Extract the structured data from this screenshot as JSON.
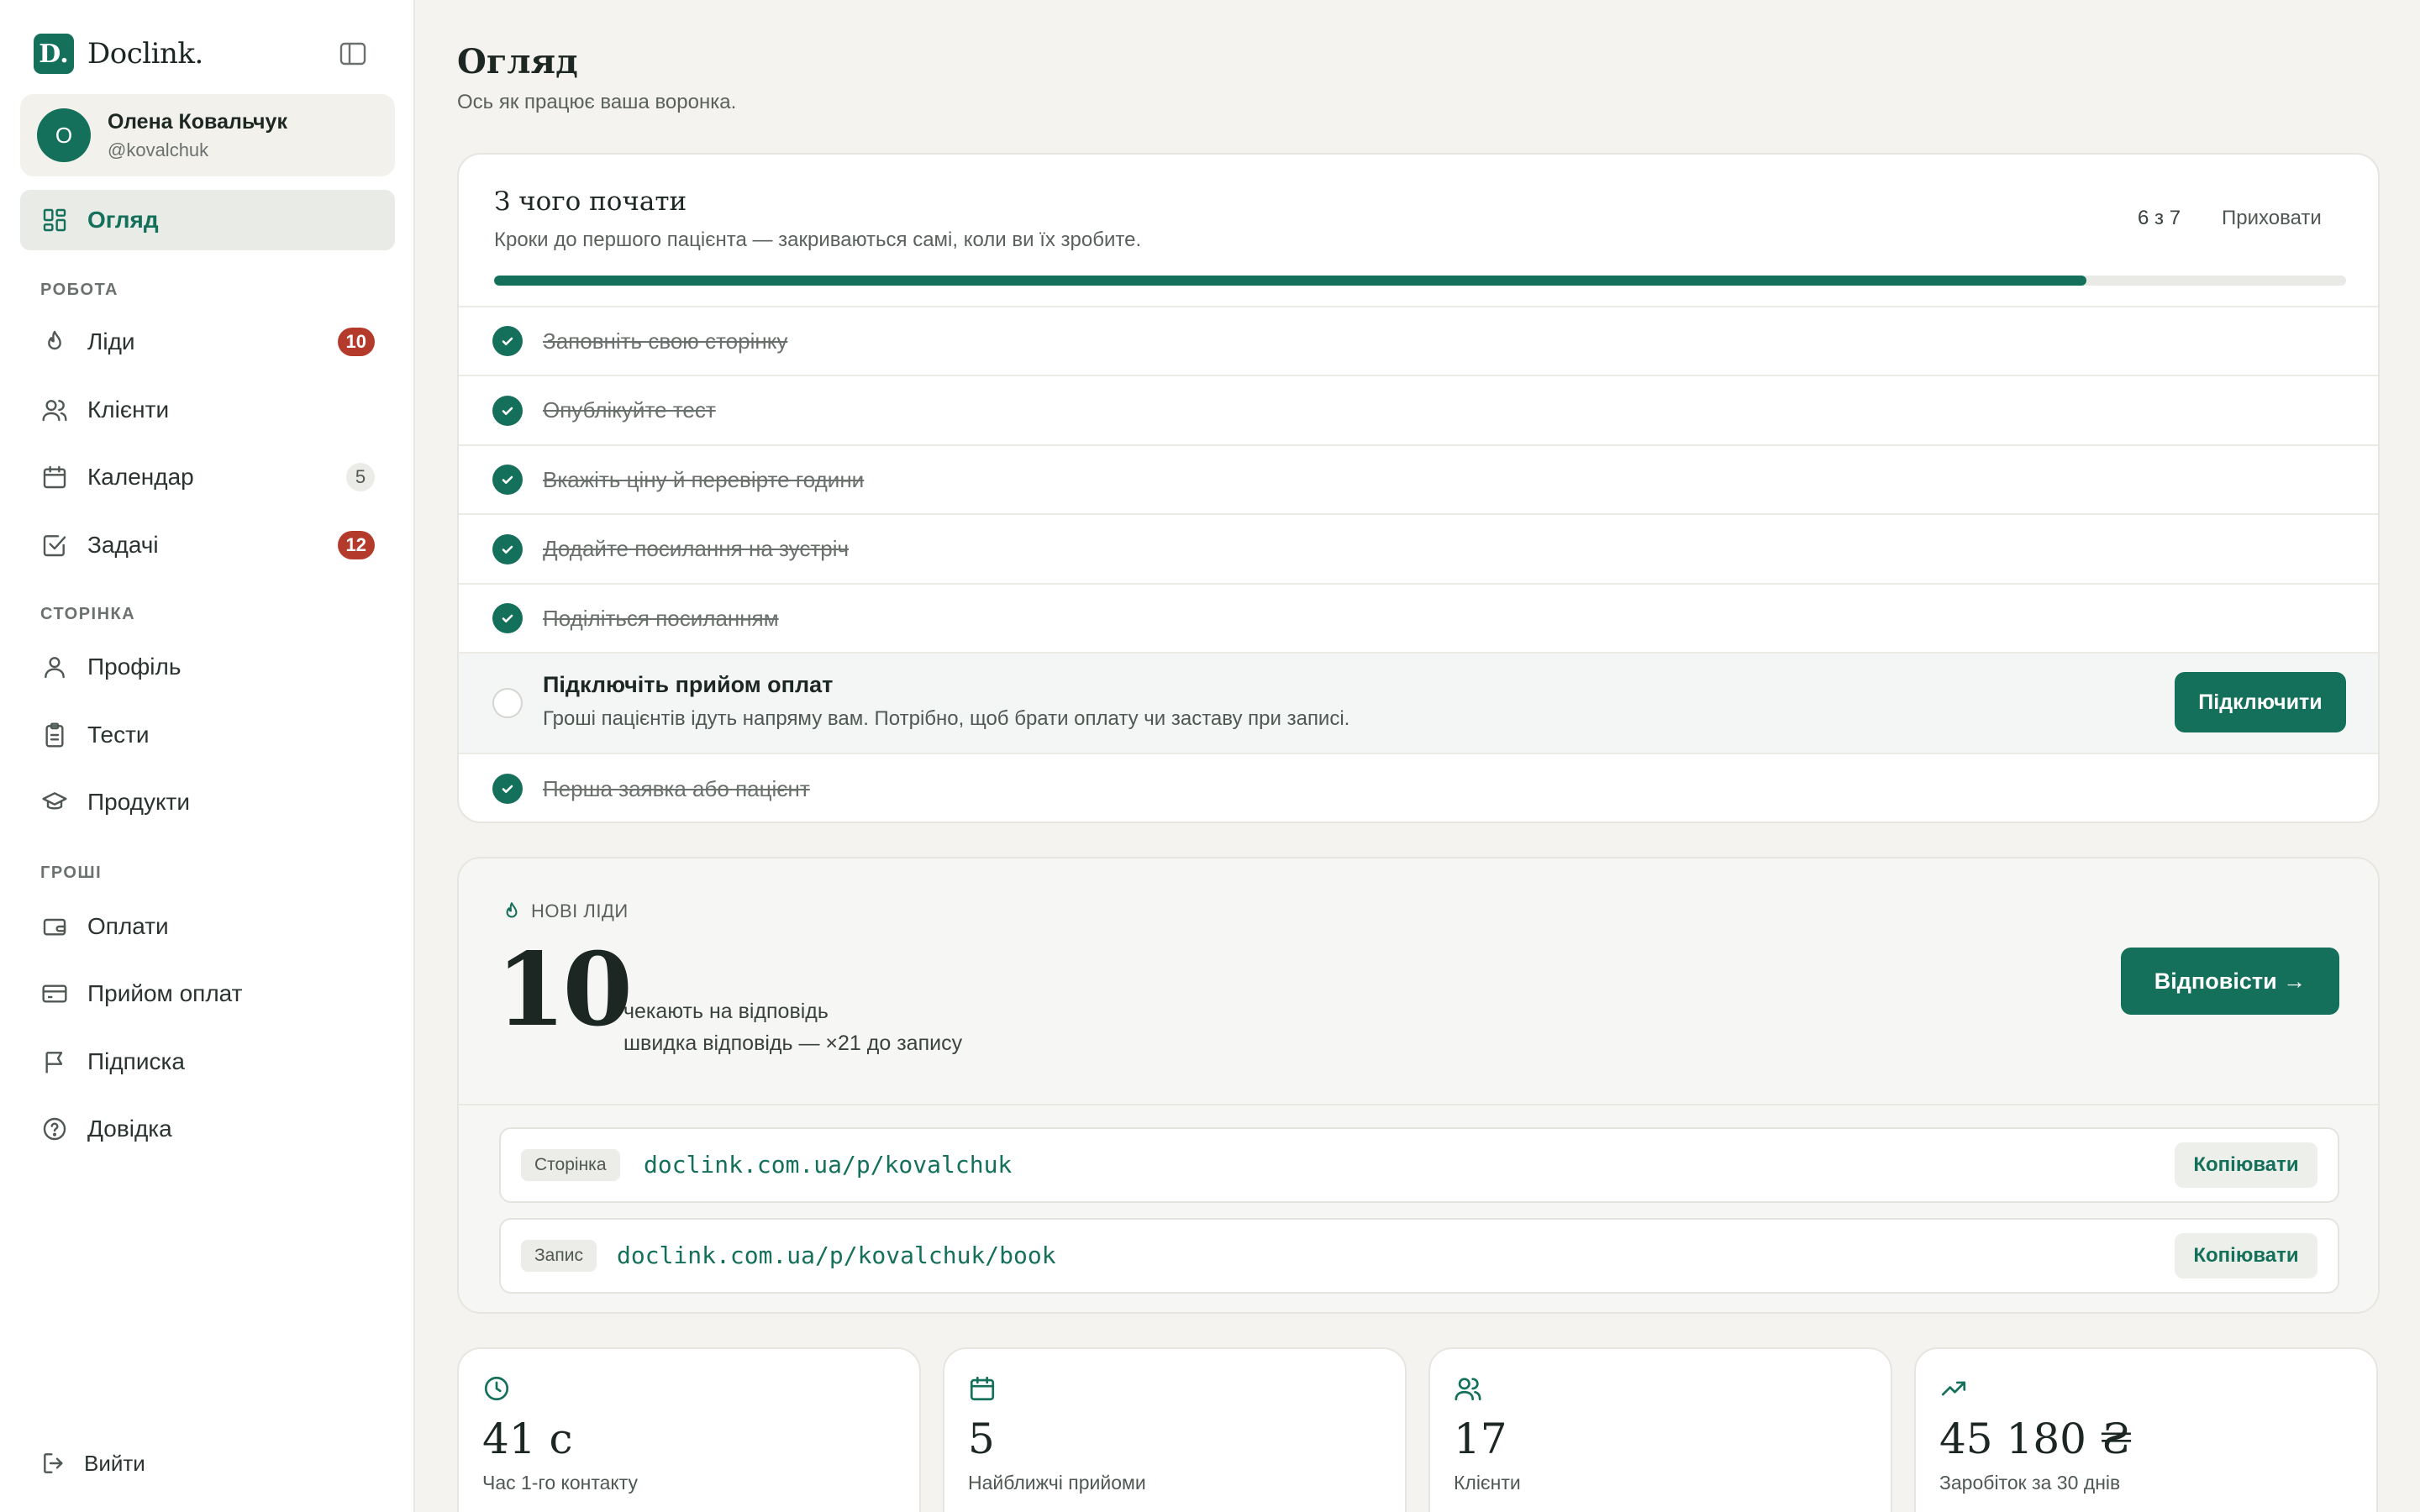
{
  "brand": {
    "logo_letter": "D.",
    "name": "Doclink."
  },
  "user": {
    "initial": "О",
    "name": "Олена Ковальчук",
    "handle": "@kovalchuk"
  },
  "nav": {
    "overview": "Огляд",
    "section_work": "РОБОТА",
    "leads": "Ліди",
    "leads_badge": "10",
    "clients": "Клієнти",
    "calendar": "Календар",
    "calendar_badge": "5",
    "tasks": "Задачі",
    "tasks_badge": "12",
    "section_page": "СТОРІНКА",
    "profile": "Профіль",
    "tests": "Тести",
    "products": "Продукти",
    "section_money": "ГРОШІ",
    "payments": "Оплати",
    "accept_payments": "Прийом оплат",
    "subscription": "Підписка",
    "help": "Довідка",
    "logout": "Вийти"
  },
  "page": {
    "title": "Огляд",
    "subtitle": "Ось як працює ваша воронка."
  },
  "onboarding": {
    "title": "З чого почати",
    "subtitle": "Кроки до першого пацієнта — закриваються самі, коли ви їх зробите.",
    "count": "6 з 7",
    "progress": 0.86,
    "hide": "Приховати",
    "steps": [
      {
        "label": "Заповніть свою сторінку",
        "done": true
      },
      {
        "label": "Опублікуйте тест",
        "done": true
      },
      {
        "label": "Вкажіть ціну й перевірте години",
        "done": true
      },
      {
        "label": "Додайте посилання на зустріч",
        "done": true
      },
      {
        "label": "Поділіться посиланням",
        "done": true
      },
      {
        "label": "Підключіть прийом оплат",
        "done": false,
        "description": "Гроші пацієнтів ідуть напряму вам. Потрібно, щоб брати оплату чи заставу при записі.",
        "action": "Підключити"
      },
      {
        "label": "Перша заявка або пацієнт",
        "done": true
      }
    ]
  },
  "leads": {
    "heading": "НОВІ ЛІДИ",
    "count": "10",
    "line1": "чекають на відповідь",
    "line2": "швидка відповідь — ×21 до запису",
    "reply_button": "Відповісти →"
  },
  "links": [
    {
      "tag": "Сторінка",
      "url": "doclink.com.ua/p/kovalchuk",
      "copy": "Копіювати"
    },
    {
      "tag": "Запис",
      "url": "doclink.com.ua/p/kovalchuk/book",
      "copy": "Копіювати"
    }
  ],
  "stats": [
    {
      "icon": "clock-icon",
      "value": "41 с",
      "label": "Час 1-го контакту"
    },
    {
      "icon": "calendar-icon",
      "value": "5",
      "label": "Найближчі прийоми"
    },
    {
      "icon": "users-icon",
      "value": "17",
      "label": "Клієнти"
    },
    {
      "icon": "trending-up-icon",
      "value": "45 180 ₴",
      "label": "Заробіток за 30 днів"
    }
  ],
  "colors": {
    "accent": "#14705a",
    "badge_red": "#b43a2c",
    "background": "#f4f3ef"
  }
}
